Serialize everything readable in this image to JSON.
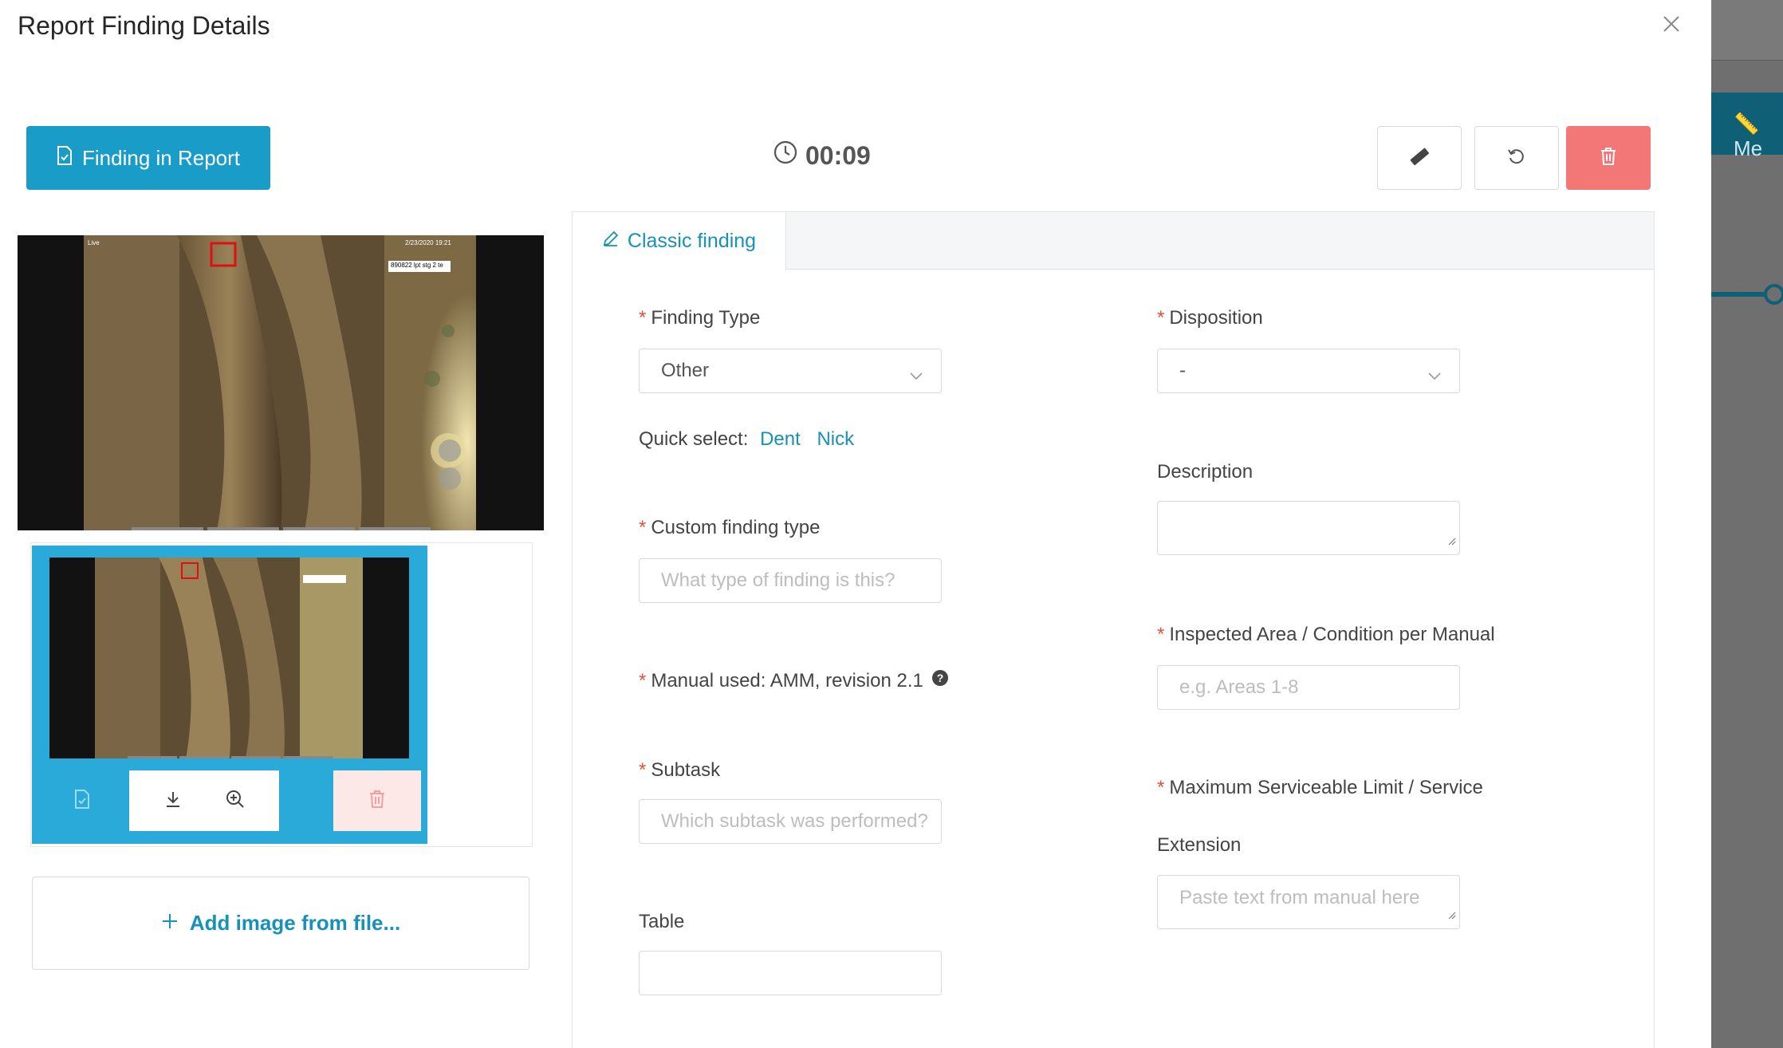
{
  "modal": {
    "title": "Report Finding Details",
    "finding_in_report_label": "Finding in Report",
    "timer": "00:09",
    "add_image_label": "Add image from file..."
  },
  "images": {
    "overlay_tag": "890822 lpt stg 2 te",
    "overlay_date": "2/23/2020  19:21",
    "overlay_live": "Live"
  },
  "tabs": [
    {
      "label": "Classic finding"
    }
  ],
  "form": {
    "finding_type": {
      "label": "Finding Type",
      "value": "Other"
    },
    "quick_select": {
      "label": "Quick select:",
      "options": [
        "Dent",
        "Nick"
      ]
    },
    "custom_finding_type": {
      "label": "Custom finding type",
      "placeholder": "What type of finding is this?"
    },
    "manual_used": {
      "label": "Manual used: AMM, revision 2.1"
    },
    "subtask": {
      "label": "Subtask",
      "placeholder": "Which subtask was performed?"
    },
    "table": {
      "label": "Table",
      "value": ""
    },
    "disposition": {
      "label": "Disposition",
      "value": "-"
    },
    "description": {
      "label": "Description",
      "value": ""
    },
    "inspected_area": {
      "label": "Inspected Area / Condition per Manual",
      "placeholder": "e.g. Areas 1-8"
    },
    "max_serviceable": {
      "label": "Maximum Serviceable Limit / Service",
      "label_line2": "Extension",
      "placeholder": "Paste text from manual here"
    }
  },
  "background": {
    "partial_label": "Me"
  },
  "colors": {
    "accent": "#1a9cc9",
    "danger": "#f47777",
    "required": "#e0533c"
  }
}
